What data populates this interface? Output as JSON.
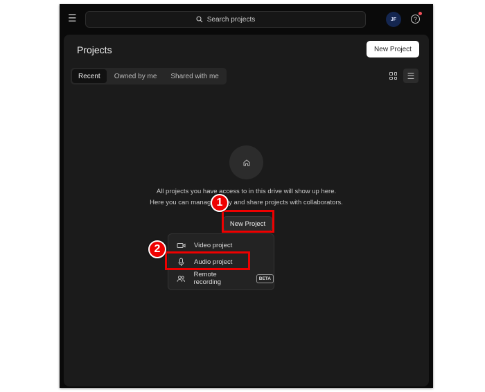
{
  "topbar": {
    "search_placeholder": "Search projects",
    "avatar_initials": "JF",
    "notification_color": "#f0505a"
  },
  "header": {
    "title": "Projects",
    "new_project_label": "New Project"
  },
  "tabs": [
    {
      "label": "Recent",
      "active": true
    },
    {
      "label": "Owned by me"
    },
    {
      "label": "Shared with me"
    }
  ],
  "view": {
    "selected": "list"
  },
  "empty_state": {
    "icon": "home-icon",
    "line1": "All projects you have access to in this drive will show up here.",
    "line2": "Here you can manage, copy and share projects with collaborators.",
    "button_label": "New Project"
  },
  "dropdown": {
    "items": [
      {
        "icon": "video-icon",
        "label": "Video project"
      },
      {
        "icon": "microphone-icon",
        "label": "Audio project"
      },
      {
        "icon": "users-icon",
        "label": "Remote recording",
        "badge": "BETA"
      }
    ]
  },
  "annotations": {
    "step1": "1",
    "step2": "2",
    "color": "#e00000"
  }
}
